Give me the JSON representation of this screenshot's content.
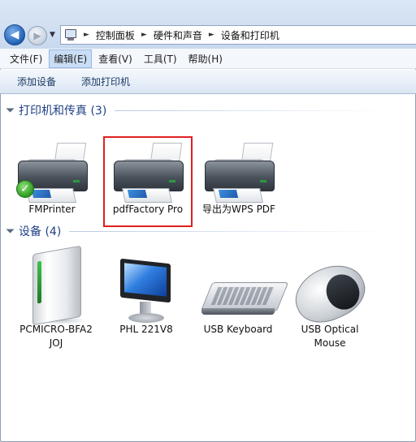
{
  "address_bar": {
    "breadcrumbs": [
      "控制面板",
      "硬件和声音",
      "设备和打印机"
    ]
  },
  "menu": {
    "items": [
      "文件(F)",
      "编辑(E)",
      "查看(V)",
      "工具(T)",
      "帮助(H)"
    ],
    "active": "编辑(E)"
  },
  "commands": [
    "添加设备",
    "添加打印机"
  ],
  "groups": {
    "printers": {
      "title": "打印机和传真 (3)",
      "items": [
        {
          "label": "FMPrinter",
          "icon": "printer-icon",
          "default": true
        },
        {
          "label": "pdfFactory Pro",
          "icon": "printer-icon",
          "selected": true
        },
        {
          "label": "导出为WPS PDF",
          "icon": "printer-icon"
        }
      ]
    },
    "devices": {
      "title": "设备 (4)",
      "items": [
        {
          "label_line1": "PCMICRO-BFA2",
          "label_line2": "JOJ",
          "icon": "computer-tower-icon"
        },
        {
          "label_line1": "PHL 221V8",
          "label_line2": "",
          "icon": "monitor-icon"
        },
        {
          "label_line1": "USB Keyboard",
          "label_line2": "",
          "icon": "keyboard-icon"
        },
        {
          "label_line1": "USB Optical",
          "label_line2": "Mouse",
          "icon": "mouse-icon"
        }
      ]
    }
  },
  "colors": {
    "selection_highlight": "#e02020",
    "group_title": "#1e3f84",
    "default_check": "#2b9a1f"
  }
}
